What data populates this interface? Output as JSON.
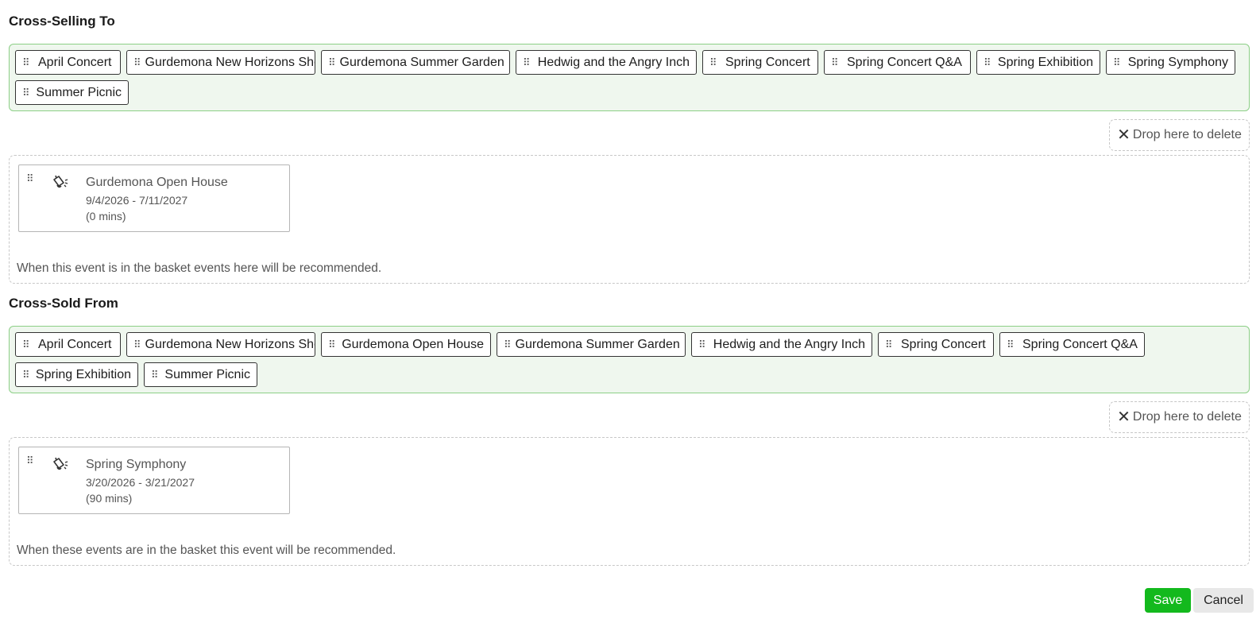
{
  "cross_selling_to": {
    "title": "Cross-Selling To",
    "available": [
      {
        "label": "April Concert",
        "width": 133
      },
      {
        "label": "Gurdemona New Horizons Show",
        "width": 238
      },
      {
        "label": "Gurdemona Summer Garden",
        "width": 238
      },
      {
        "label": "Hedwig and the Angry Inch",
        "width": 228
      },
      {
        "label": "Spring Concert",
        "width": 146
      },
      {
        "label": "Spring Concert Q&A",
        "width": 185
      },
      {
        "label": "Spring Exhibition",
        "width": 156
      },
      {
        "label": "Spring Symphony",
        "width": 163
      },
      {
        "label": "Summer Picnic",
        "width": 143
      }
    ],
    "delete_label": "Drop here to delete",
    "selected": {
      "name": "Gurdemona Open House",
      "dates": "9/4/2026 - 7/11/2027",
      "duration": "(0 mins)"
    },
    "help": "When this event is in the basket events here will be recommended."
  },
  "cross_sold_from": {
    "title": "Cross-Sold From",
    "available": [
      {
        "label": "April Concert",
        "width": 133
      },
      {
        "label": "Gurdemona New Horizons Show",
        "width": 238
      },
      {
        "label": "Gurdemona Open House",
        "width": 214
      },
      {
        "label": "Gurdemona Summer Garden",
        "width": 238
      },
      {
        "label": "Hedwig and the Angry Inch",
        "width": 228
      },
      {
        "label": "Spring Concert",
        "width": 146
      },
      {
        "label": "Spring Concert Q&A",
        "width": 183
      },
      {
        "label": "Spring Exhibition",
        "width": 155
      },
      {
        "label": "Summer Picnic",
        "width": 143
      }
    ],
    "delete_label": "Drop here to delete",
    "selected": {
      "name": "Spring Symphony",
      "dates": "3/20/2026 - 3/21/2027",
      "duration": "(90 mins)"
    },
    "help": "When these events are in the basket this event will be recommended."
  },
  "actions": {
    "save_label": "Save",
    "cancel_label": "Cancel"
  },
  "colors": {
    "pool_bg": "#eff7ee",
    "pool_border": "#8ccf86",
    "save_bg": "#13b91d"
  },
  "icons": {
    "grip": "drag-handle-icon",
    "event": "bell-icon",
    "delete": "close-icon"
  }
}
